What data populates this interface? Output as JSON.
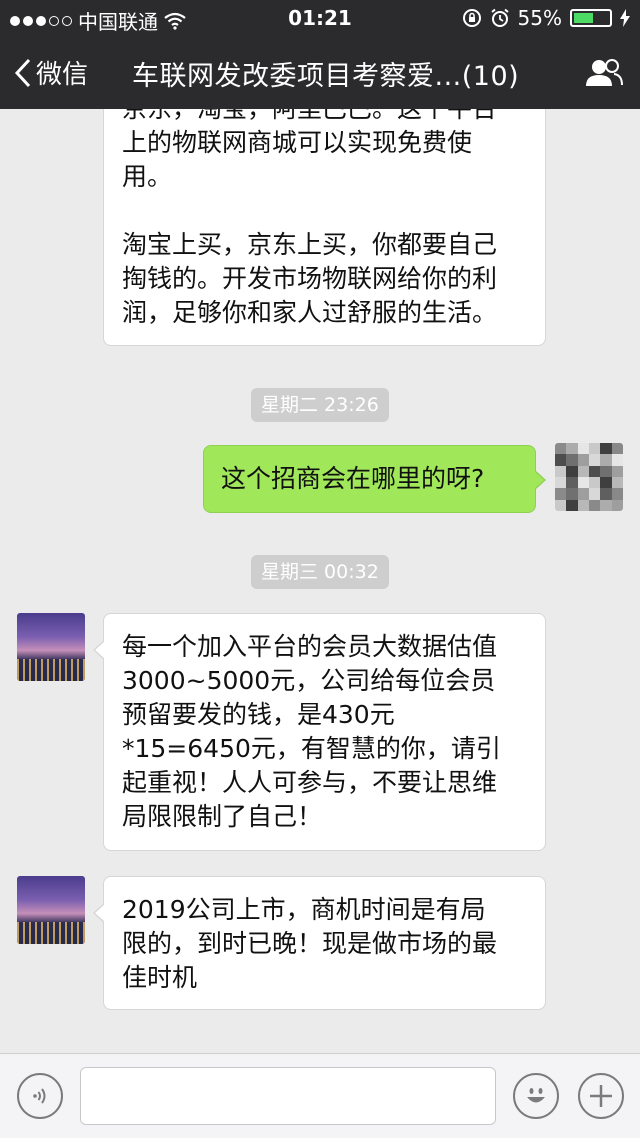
{
  "status_bar": {
    "carrier": "中国联通",
    "time": "01:21",
    "battery_percent": "55%",
    "battery_level": 0.55,
    "signal_bars": 3,
    "signal_total": 5
  },
  "nav": {
    "back_label": "微信",
    "title": "车联网发改委项目考察爱...(10)"
  },
  "messages": [
    {
      "id": "m1",
      "side": "left",
      "paragraphs": [
        "京东，淘宝，阿里巴巴。这个平台上的物联网商城可以实现免费使用。",
        "淘宝上买，京东上买，你都要自己掏钱的。开发市场物联网给你的利润，足够你和家人过舒服的生活。"
      ],
      "lines": [
        "京东，淘宝，阿里巴巴。这个平台",
        "上的物联网商城可以实现免费使",
        "用。",
        "",
        "淘宝上买，京东上买，你都要自己",
        "掏钱的。开发市场物联网给你的利",
        "润，足够你和家人过舒服的生活。"
      ]
    },
    {
      "id": "t1",
      "type": "timestamp",
      "text": "星期二 23:26"
    },
    {
      "id": "m2",
      "side": "right",
      "lines": [
        "这个招商会在哪里的呀?"
      ]
    },
    {
      "id": "t2",
      "type": "timestamp",
      "text": "星期三 00:32"
    },
    {
      "id": "m3",
      "side": "left",
      "lines": [
        "每一个加入平台的会员大数据估值",
        "3000~5000元，公司给每位会员",
        "预留要发的钱，是430元",
        "*15=6450元，有智慧的你，请引",
        "起重视！人人可参与，不要让思维",
        "局限限制了自己！"
      ]
    },
    {
      "id": "m4",
      "side": "left",
      "lines": [
        "2019公司上市，商机时间是有局",
        "限的，到时已晚！现是做市场的最",
        "佳时机"
      ]
    }
  ],
  "input_bar": {
    "voice_icon": "voice-icon",
    "emoji_icon": "emoji-icon",
    "plus_icon": "plus-icon",
    "text_value": ""
  },
  "colors": {
    "nav_bg": "#2b2b2e",
    "chat_bg": "#ebebeb",
    "sent_bubble": "#a0e75a",
    "received_bubble": "#ffffff",
    "timestamp_bg": "#cecece"
  }
}
